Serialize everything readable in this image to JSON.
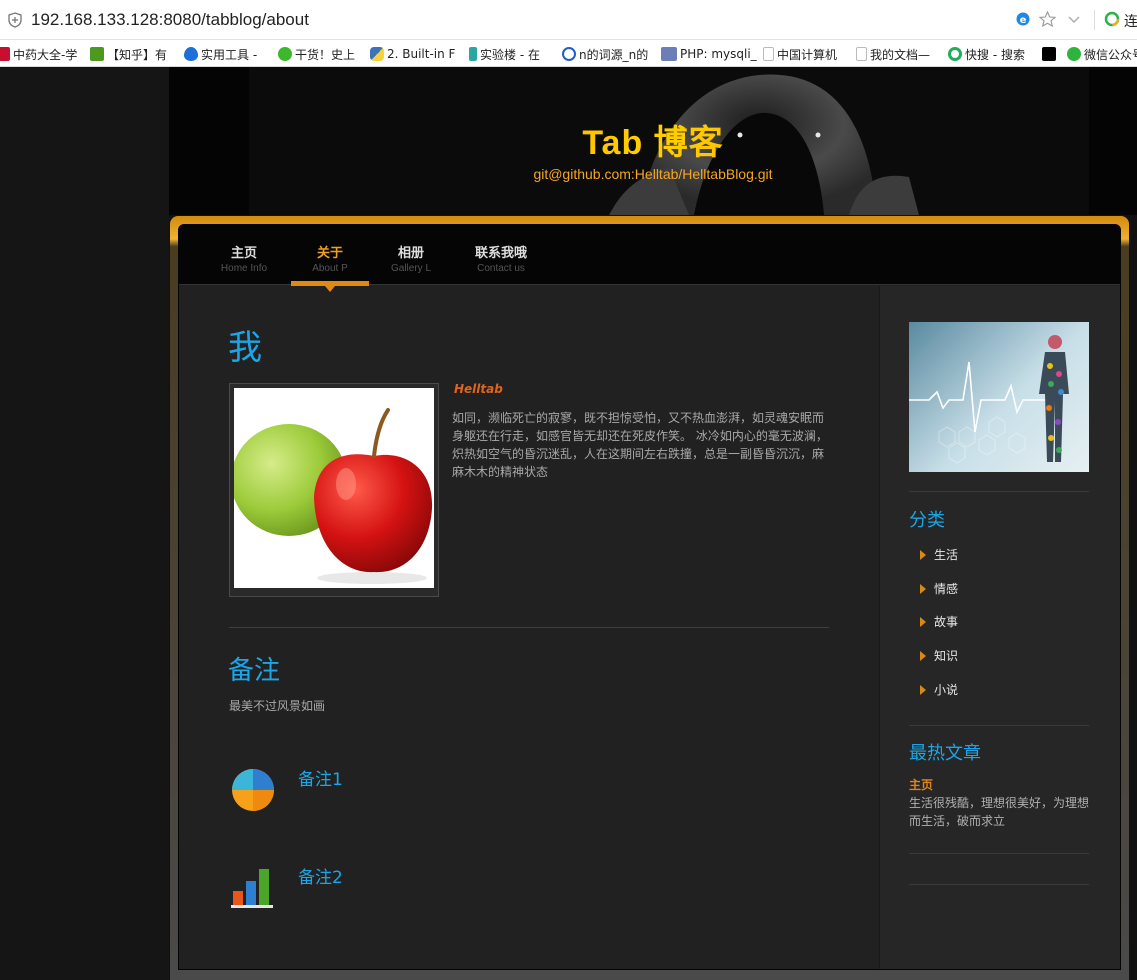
{
  "browser": {
    "url": "192.168.133.128:8080/tabblog/about",
    "right_text": "连"
  },
  "bookmarks": [
    {
      "label": "中药大全-学",
      "color": "#c8102e"
    },
    {
      "label": "【知乎】有",
      "color": "#4b9a1e"
    },
    {
      "label": "实用工具 -",
      "color": "#1e6fd9"
    },
    {
      "label": "干货！史上",
      "color": "#3cb82c"
    },
    {
      "label": "2. Built-in F",
      "color": "#3b73b9"
    },
    {
      "label": "实验楼 - 在",
      "color": "#2aa7a0"
    },
    {
      "label": "n的词源_n的",
      "color": "#1e5fc8"
    },
    {
      "label": "PHP: mysqli_",
      "color": "#6c7eb7"
    },
    {
      "label": "中国计算机",
      "color": "#bbbbbb"
    },
    {
      "label": "我的文档—",
      "color": "#bbbbbb"
    },
    {
      "label": "快搜 - 搜索",
      "color": "#1fae5c"
    },
    {
      "label": "",
      "color": "#000000"
    },
    {
      "label": "微信公众号",
      "color": "#2eb43c"
    }
  ],
  "header": {
    "title": "Tab 博客",
    "subtitle": "git@github.com:Helltab/HelltabBlog.git"
  },
  "nav": [
    {
      "title": "主页",
      "sub": "Home Info"
    },
    {
      "title": "关于",
      "sub": "About P"
    },
    {
      "title": "相册",
      "sub": "Gallery L"
    },
    {
      "title": "联系我哦",
      "sub": "Contact us"
    }
  ],
  "main": {
    "heading": "我",
    "author": "Helltab",
    "bio": "如同，濒临死亡的寂寥，既不担惊受怕，又不热血澎湃，如灵魂安眠而身躯还在行走，如感官皆无却还在死皮作笑。 冰冷如内心的毫无波澜，炽热如空气的昏沉迷乱，人在这期间左右跌撞，总是一副昏昏沉沉，麻麻木木的精神状态",
    "note_heading": "备注",
    "note_sub": "最美不过风景如画",
    "notes": [
      {
        "title": "备注1",
        "icon": "pie-chart-icon"
      },
      {
        "title": "备注2",
        "icon": "bar-chart-icon"
      }
    ]
  },
  "sidebar": {
    "categories_heading": "分类",
    "categories": [
      "生活",
      "情感",
      "故事",
      "知识",
      "小说"
    ],
    "hot_heading": "最热文章",
    "hot_title": "主页",
    "hot_desc": "生活很残酷，理想很美好，为理想而生活，破而求立"
  },
  "colors": {
    "accent_orange": "#e08a14",
    "accent_blue": "#1aa6e8",
    "content_bg": "#212121"
  }
}
